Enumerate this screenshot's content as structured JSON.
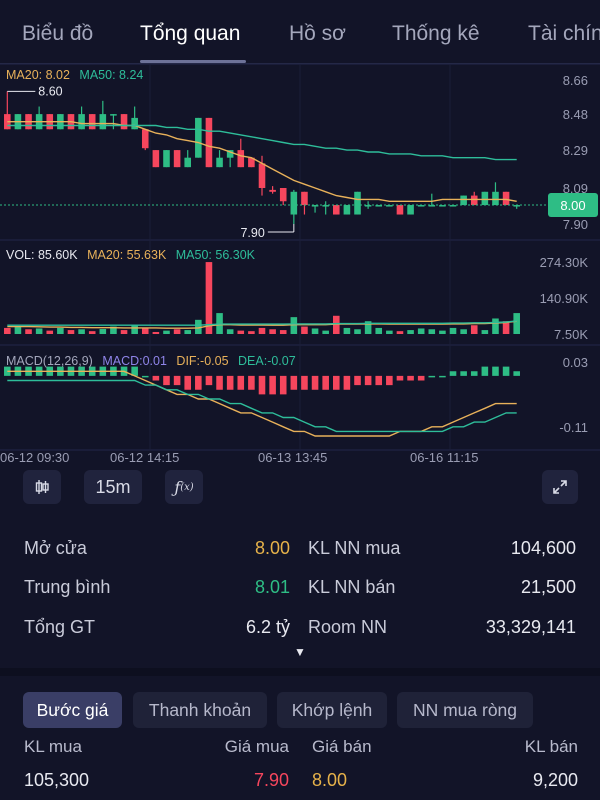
{
  "tabs": [
    "Biểu đồ",
    "Tổng quan",
    "Hồ sơ",
    "Thống kê",
    "Tài chính"
  ],
  "active_tab": 1,
  "colors": {
    "up": "#2ebd85",
    "down": "#f6465d",
    "ref": "#e6b24a",
    "ma20": "#e8b15a",
    "ma50": "#2ebd9a",
    "macd_label": "#8f84e8",
    "background": "#121428"
  },
  "price_panel": {
    "ma20_label": "MA20: 8.02",
    "ma50_label": "MA50: 8.24",
    "high_marker": "8.60",
    "low_marker": "7.90",
    "current_price": "8.00",
    "axis_ticks": [
      "8.66",
      "8.48",
      "8.29",
      "8.09",
      "7.90"
    ]
  },
  "volume_panel": {
    "vol_label": "VOL: 85.60K",
    "ma20_label": "MA20: 55.63K",
    "ma50_label": "MA50: 56.30K",
    "axis_ticks": [
      "274.30K",
      "140.90K",
      "7.50K"
    ]
  },
  "macd_panel": {
    "title": "MACD(12,26,9)",
    "macd_label": "MACD:0.01",
    "dif_label": "DIF:-0.05",
    "dea_label": "DEA:-0.07",
    "axis_ticks": [
      "0.03",
      "-0.11"
    ]
  },
  "time_axis": [
    "06-12 09:30",
    "06-12 14:15",
    "06-13 13:45",
    "06-16 11:15"
  ],
  "toolbar": {
    "candle_icon": "candlestick-icon",
    "interval": "15m",
    "indicator_icon": "function-icon",
    "expand_icon": "fullscreen-icon"
  },
  "chart_data": {
    "type": "candlestick",
    "candles": [
      {
        "o": 8.48,
        "c": 8.4,
        "h": 8.6,
        "l": 8.4
      },
      {
        "o": 8.4,
        "c": 8.48,
        "h": 8.48,
        "l": 8.4
      },
      {
        "o": 8.48,
        "c": 8.4,
        "h": 8.48,
        "l": 8.4
      },
      {
        "o": 8.4,
        "c": 8.48,
        "h": 8.52,
        "l": 8.4
      },
      {
        "o": 8.48,
        "c": 8.4,
        "h": 8.48,
        "l": 8.4
      },
      {
        "o": 8.4,
        "c": 8.48,
        "h": 8.48,
        "l": 8.4
      },
      {
        "o": 8.48,
        "c": 8.4,
        "h": 8.48,
        "l": 8.4
      },
      {
        "o": 8.4,
        "c": 8.48,
        "h": 8.52,
        "l": 8.4
      },
      {
        "o": 8.48,
        "c": 8.4,
        "h": 8.48,
        "l": 8.4
      },
      {
        "o": 8.4,
        "c": 8.48,
        "h": 8.55,
        "l": 8.4
      },
      {
        "o": 8.48,
        "c": 8.48,
        "h": 8.48,
        "l": 8.4
      },
      {
        "o": 8.48,
        "c": 8.4,
        "h": 8.48,
        "l": 8.4
      },
      {
        "o": 8.4,
        "c": 8.46,
        "h": 8.52,
        "l": 8.4
      },
      {
        "o": 8.4,
        "c": 8.3,
        "h": 8.4,
        "l": 8.29
      },
      {
        "o": 8.29,
        "c": 8.2,
        "h": 8.29,
        "l": 8.2
      },
      {
        "o": 8.2,
        "c": 8.29,
        "h": 8.29,
        "l": 8.2
      },
      {
        "o": 8.29,
        "c": 8.2,
        "h": 8.29,
        "l": 8.2
      },
      {
        "o": 8.2,
        "c": 8.25,
        "h": 8.29,
        "l": 8.2
      },
      {
        "o": 8.25,
        "c": 8.46,
        "h": 8.46,
        "l": 8.25
      },
      {
        "o": 8.46,
        "c": 8.2,
        "h": 8.46,
        "l": 8.2
      },
      {
        "o": 8.2,
        "c": 8.25,
        "h": 8.29,
        "l": 8.2
      },
      {
        "o": 8.25,
        "c": 8.29,
        "h": 8.29,
        "l": 8.2
      },
      {
        "o": 8.29,
        "c": 8.2,
        "h": 8.35,
        "l": 8.2
      },
      {
        "o": 8.25,
        "c": 8.2,
        "h": 8.25,
        "l": 8.2
      },
      {
        "o": 8.22,
        "c": 8.09,
        "h": 8.26,
        "l": 8.05
      },
      {
        "o": 8.08,
        "c": 8.07,
        "h": 8.1,
        "l": 8.06
      },
      {
        "o": 8.09,
        "c": 8.02,
        "h": 8.09,
        "l": 8.0
      },
      {
        "o": 7.95,
        "c": 8.07,
        "h": 8.08,
        "l": 7.9
      },
      {
        "o": 8.07,
        "c": 8.0,
        "h": 8.07,
        "l": 7.95
      },
      {
        "o": 8.0,
        "c": 8.0,
        "h": 8.0,
        "l": 7.96
      },
      {
        "o": 8.0,
        "c": 8.0,
        "h": 8.02,
        "l": 7.95
      },
      {
        "o": 8.0,
        "c": 7.95,
        "h": 8.0,
        "l": 7.95
      },
      {
        "o": 7.95,
        "c": 8.0,
        "h": 8.0,
        "l": 7.95
      },
      {
        "o": 7.95,
        "c": 8.07,
        "h": 8.07,
        "l": 7.95
      },
      {
        "o": 8.0,
        "c": 8.0,
        "h": 8.02,
        "l": 7.98
      },
      {
        "o": 8.0,
        "c": 8.0,
        "h": 8.0,
        "l": 8.0
      },
      {
        "o": 8.0,
        "c": 8.0,
        "h": 8.0,
        "l": 8.0
      },
      {
        "o": 8.0,
        "c": 7.95,
        "h": 8.0,
        "l": 7.95
      },
      {
        "o": 7.95,
        "c": 8.0,
        "h": 8.0,
        "l": 7.95
      },
      {
        "o": 8.0,
        "c": 8.0,
        "h": 8.0,
        "l": 8.0
      },
      {
        "o": 8.0,
        "c": 8.0,
        "h": 8.06,
        "l": 8.0
      },
      {
        "o": 8.0,
        "c": 8.0,
        "h": 8.0,
        "l": 8.0
      },
      {
        "o": 8.0,
        "c": 8.0,
        "h": 8.0,
        "l": 8.0
      },
      {
        "o": 8.0,
        "c": 8.05,
        "h": 8.05,
        "l": 8.0
      },
      {
        "o": 8.05,
        "c": 8.0,
        "h": 8.07,
        "l": 8.0
      },
      {
        "o": 8.0,
        "c": 8.07,
        "h": 8.07,
        "l": 8.0
      },
      {
        "o": 8.0,
        "c": 8.07,
        "h": 8.12,
        "l": 8.0
      },
      {
        "o": 8.07,
        "c": 8.0,
        "h": 8.07,
        "l": 8.0
      },
      {
        "o": 8.0,
        "c": 8.0,
        "h": 8.0,
        "l": 7.98
      }
    ],
    "ma20": [
      8.44,
      8.44,
      8.44,
      8.44,
      8.44,
      8.44,
      8.44,
      8.43,
      8.43,
      8.43,
      8.43,
      8.42,
      8.42,
      8.4,
      8.38,
      8.37,
      8.35,
      8.34,
      8.33,
      8.31,
      8.3,
      8.28,
      8.26,
      8.25,
      8.22,
      8.19,
      8.16,
      8.13,
      8.11,
      8.09,
      8.07,
      8.05,
      8.04,
      8.03,
      8.03,
      8.03,
      8.02,
      8.02,
      8.02,
      8.02,
      8.02,
      8.03,
      8.03,
      8.03,
      8.03,
      8.03,
      8.03,
      8.03,
      8.02
    ],
    "ma50": [
      8.42,
      8.42,
      8.42,
      8.42,
      8.42,
      8.42,
      8.42,
      8.42,
      8.42,
      8.42,
      8.42,
      8.42,
      8.42,
      8.42,
      8.42,
      8.41,
      8.41,
      8.4,
      8.4,
      8.39,
      8.39,
      8.38,
      8.37,
      8.36,
      8.35,
      8.34,
      8.33,
      8.32,
      8.32,
      8.31,
      8.3,
      8.3,
      8.29,
      8.29,
      8.28,
      8.28,
      8.27,
      8.27,
      8.27,
      8.26,
      8.26,
      8.26,
      8.25,
      8.25,
      8.25,
      8.25,
      8.24,
      8.24,
      8.24
    ],
    "volume": [
      30,
      35,
      25,
      28,
      20,
      30,
      22,
      25,
      18,
      26,
      35,
      22,
      40,
      30,
      15,
      20,
      25,
      22,
      60,
      274,
      85,
      25,
      20,
      18,
      30,
      25,
      22,
      70,
      35,
      28,
      20,
      75,
      30,
      25,
      55,
      30,
      20,
      18,
      22,
      28,
      25,
      20,
      30,
      25,
      40,
      22,
      65,
      55,
      85
    ],
    "vol_ma20": [
      35,
      35,
      35,
      34,
      33,
      33,
      32,
      32,
      31,
      31,
      31,
      30,
      30,
      30,
      30,
      29,
      29,
      29,
      30,
      38,
      42,
      42,
      41,
      41,
      41,
      40,
      40,
      42,
      42,
      42,
      42,
      44,
      44,
      44,
      45,
      45,
      44,
      44,
      44,
      44,
      44,
      44,
      45,
      45,
      46,
      46,
      48,
      50,
      55
    ],
    "vol_ma50": [
      40,
      40,
      40,
      40,
      40,
      40,
      40,
      40,
      40,
      40,
      40,
      40,
      40,
      40,
      40,
      40,
      40,
      40,
      40,
      42,
      44,
      44,
      44,
      44,
      44,
      44,
      44,
      45,
      45,
      45,
      45,
      46,
      46,
      46,
      47,
      47,
      47,
      47,
      47,
      47,
      47,
      47,
      48,
      48,
      49,
      49,
      50,
      52,
      56
    ],
    "macd_hist": [
      0.02,
      0.02,
      0.02,
      0.02,
      0.02,
      0.02,
      0.02,
      0.02,
      0.02,
      0.02,
      0.02,
      0.02,
      0.02,
      0.0,
      -0.01,
      -0.02,
      -0.02,
      -0.03,
      -0.03,
      -0.02,
      -0.03,
      -0.03,
      -0.03,
      -0.03,
      -0.04,
      -0.04,
      -0.04,
      -0.03,
      -0.03,
      -0.03,
      -0.03,
      -0.03,
      -0.03,
      -0.02,
      -0.02,
      -0.02,
      -0.02,
      -0.01,
      -0.01,
      -0.01,
      0.0,
      0.0,
      0.01,
      0.01,
      0.01,
      0.02,
      0.02,
      0.02,
      0.01
    ],
    "dif": [
      0.01,
      0.01,
      0.01,
      0.01,
      0.01,
      0.01,
      0.01,
      0.01,
      0.01,
      0.01,
      0.01,
      0.01,
      0.0,
      -0.01,
      -0.02,
      -0.03,
      -0.04,
      -0.04,
      -0.05,
      -0.05,
      -0.06,
      -0.07,
      -0.08,
      -0.08,
      -0.09,
      -0.1,
      -0.11,
      -0.12,
      -0.12,
      -0.13,
      -0.13,
      -0.13,
      -0.13,
      -0.13,
      -0.13,
      -0.13,
      -0.13,
      -0.12,
      -0.12,
      -0.12,
      -0.11,
      -0.11,
      -0.1,
      -0.09,
      -0.08,
      -0.07,
      -0.06,
      -0.06,
      -0.06
    ],
    "dea": [
      -0.01,
      -0.01,
      -0.01,
      -0.01,
      -0.01,
      -0.01,
      -0.01,
      -0.01,
      -0.01,
      -0.01,
      -0.01,
      -0.01,
      -0.01,
      -0.02,
      -0.02,
      -0.03,
      -0.03,
      -0.04,
      -0.04,
      -0.05,
      -0.05,
      -0.06,
      -0.06,
      -0.07,
      -0.08,
      -0.08,
      -0.09,
      -0.09,
      -0.1,
      -0.11,
      -0.11,
      -0.12,
      -0.12,
      -0.12,
      -0.12,
      -0.12,
      -0.12,
      -0.12,
      -0.12,
      -0.12,
      -0.12,
      -0.12,
      -0.11,
      -0.11,
      -0.1,
      -0.1,
      -0.09,
      -0.08,
      -0.08
    ],
    "price_range": [
      7.9,
      8.66
    ],
    "volume_range": [
      7.5,
      274.3
    ],
    "macd_range": [
      -0.13,
      0.03
    ]
  },
  "stats": {
    "open_label": "Mở cửa",
    "open_value": "8.00",
    "avg_label": "Trung bình",
    "avg_value": "8.01",
    "total_label": "Tổng GT",
    "total_value": "6.2 tỷ",
    "foreign_buy_label": "KL NN mua",
    "foreign_buy_value": "104,600",
    "foreign_sell_label": "KL NN bán",
    "foreign_sell_value": "21,500",
    "room_label": "Room NN",
    "room_value": "33,329,141"
  },
  "segments": [
    "Bước giá",
    "Thanh khoản",
    "Khớp lệnh",
    "NN mua ròng"
  ],
  "order_book": {
    "headers": [
      "KL mua",
      "Giá mua",
      "Giá bán",
      "KL bán"
    ],
    "rows": [
      {
        "bid_vol": "105,300",
        "bid_price": "7.90",
        "ask_price": "8.00",
        "ask_vol": "9,200"
      }
    ]
  }
}
